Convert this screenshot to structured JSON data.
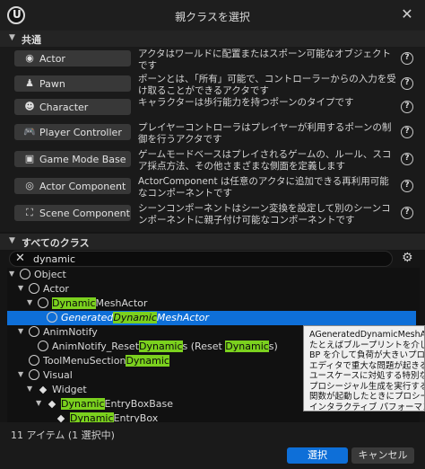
{
  "window": {
    "title": "親クラスを選択"
  },
  "common": {
    "header": "共通",
    "classes": [
      {
        "icon": "actor-icon",
        "glyph": "◉",
        "label": "Actor",
        "description": "アクタはワールドに配置またはスポーン可能なオブジェクトです"
      },
      {
        "icon": "pawn-icon",
        "glyph": "♟",
        "label": "Pawn",
        "description": "ポーンとは、「所有」可能で、コントローラーからの入力を受け取ることができるアクタです"
      },
      {
        "icon": "character-icon",
        "glyph": "☻",
        "label": "Character",
        "description": "キャラクターは歩行能力を持つポーンのタイプです"
      },
      {
        "icon": "gamepad-icon",
        "glyph": "🎮",
        "label": "Player Controller",
        "description": "プレイヤーコントローラはプレイヤーが利用するポーンの制御を行うアクタです"
      },
      {
        "icon": "game-mode-icon",
        "glyph": "▣",
        "label": "Game Mode Base",
        "description": "ゲームモードベースはプレイされるゲームの、ルール、スコア採点方法、その他さまざまな側面を定義します"
      },
      {
        "icon": "component-icon",
        "glyph": "◎",
        "label": "Actor Component",
        "description": "ActorComponent は任意のアクタに追加できる再利用可能なコンポーネントです"
      },
      {
        "icon": "scene-component-icon",
        "glyph": "⛶",
        "label": "Scene Component",
        "description": "シーンコンポーネントはシーン変換を設定して別のシーンコンポーネントに親子付け可能なコンポーネントです"
      }
    ],
    "help_glyph": "?"
  },
  "all_classes": {
    "header": "すべてのクラス",
    "search_value": "dynamic",
    "search_clear_glyph": "✕",
    "settings_glyph": "⚙",
    "tree": [
      {
        "parts": [
          [
            "Object",
            false
          ]
        ],
        "expanded": true
      },
      {
        "parts": [
          [
            "Actor",
            false
          ]
        ],
        "expanded": true
      },
      {
        "parts": [
          [
            "Dynamic",
            true
          ],
          [
            "MeshActor",
            false
          ]
        ],
        "expanded": true
      },
      {
        "parts": [
          [
            "Generated",
            false
          ],
          [
            "Dynamic",
            true
          ],
          [
            "MeshActor",
            false
          ]
        ],
        "selected": true
      },
      {
        "parts": [
          [
            "AnimNotify",
            false
          ]
        ],
        "expanded": true
      },
      {
        "parts": [
          [
            "AnimNotify_Reset",
            false
          ],
          [
            "Dynamic",
            true
          ],
          [
            "s (Reset ",
            false
          ],
          [
            "Dynamic",
            true
          ],
          [
            "s)",
            false
          ]
        ]
      },
      {
        "parts": [
          [
            "ToolMenuSection",
            false
          ],
          [
            "Dynamic",
            true
          ]
        ]
      },
      {
        "parts": [
          [
            "Visual",
            false
          ]
        ],
        "expanded": true
      },
      {
        "parts": [
          [
            "Widget",
            false
          ]
        ],
        "expanded": true
      },
      {
        "parts": [
          [
            "Dynamic",
            true
          ],
          [
            "EntryBoxBase",
            false
          ]
        ],
        "expanded": true
      },
      {
        "parts": [
          [
            "Dynamic",
            true
          ],
          [
            "EntryBox",
            false
          ]
        ]
      }
    ]
  },
  "tooltip": {
    "lines": [
      "AGeneratedDynamicMeshActor",
      "たとえばブループリントを介して、",
      "BP を介して負荷が大きいプロシー",
      "エディタで重大な問題が起きる可",
      "ユースケースに対処する特別な基",
      "プロシージャル生成を実行するの",
      "関数が起動したときにプロシージ",
      "インタラクティブ パフォーマンスが"
    ]
  },
  "footer": {
    "status": "11 アイテム (1 選択中)",
    "select_label": "選択",
    "cancel_label": "キャンセル"
  }
}
